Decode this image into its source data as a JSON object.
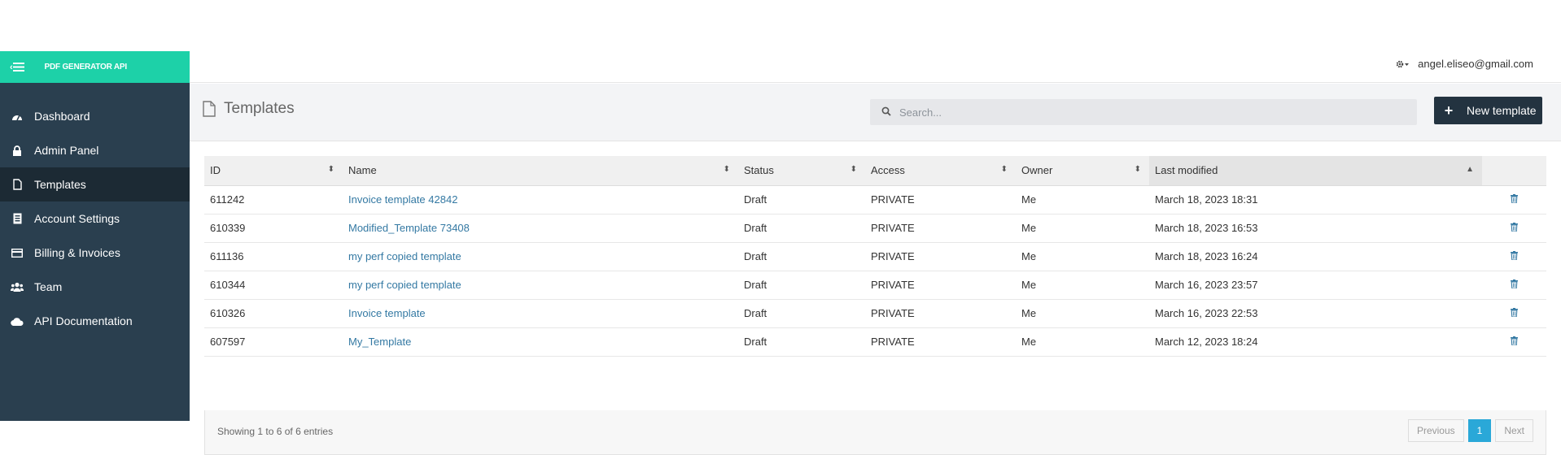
{
  "brand": {
    "name": "PDF GENERATOR API"
  },
  "sidebar": {
    "items": [
      {
        "label": "Dashboard",
        "icon": "dashboard-icon"
      },
      {
        "label": "Admin Panel",
        "icon": "lock-icon"
      },
      {
        "label": "Templates",
        "icon": "document-icon",
        "active": true
      },
      {
        "label": "Account Settings",
        "icon": "id-card-icon"
      },
      {
        "label": "Billing & Invoices",
        "icon": "credit-card-icon"
      },
      {
        "label": "Team",
        "icon": "users-icon"
      },
      {
        "label": "API Documentation",
        "icon": "cloud-icon"
      }
    ]
  },
  "header": {
    "user_email": "angel.eliseo@gmail.com"
  },
  "page": {
    "title": "Templates"
  },
  "search": {
    "placeholder": "Search..."
  },
  "toolbar": {
    "new_template_label": "New template"
  },
  "table": {
    "columns": [
      "ID",
      "Name",
      "Status",
      "Access",
      "Owner",
      "Last modified"
    ],
    "rows": [
      {
        "id": "611242",
        "name": "Invoice template 42842",
        "status": "Draft",
        "access": "PRIVATE",
        "owner": "Me",
        "modified": "March 18, 2023 18:31"
      },
      {
        "id": "610339",
        "name": "Modified_Template 73408",
        "status": "Draft",
        "access": "PRIVATE",
        "owner": "Me",
        "modified": "March 18, 2023 16:53"
      },
      {
        "id": "611136",
        "name": "my perf copied template",
        "status": "Draft",
        "access": "PRIVATE",
        "owner": "Me",
        "modified": "March 18, 2023 16:24"
      },
      {
        "id": "610344",
        "name": "my perf copied template",
        "status": "Draft",
        "access": "PRIVATE",
        "owner": "Me",
        "modified": "March 16, 2023 23:57"
      },
      {
        "id": "610326",
        "name": "Invoice template",
        "status": "Draft",
        "access": "PRIVATE",
        "owner": "Me",
        "modified": "March 16, 2023 22:53"
      },
      {
        "id": "607597",
        "name": "My_Template",
        "status": "Draft",
        "access": "PRIVATE",
        "owner": "Me",
        "modified": "March 12, 2023 18:24"
      }
    ]
  },
  "footer": {
    "info": "Showing 1 to 6 of 6 entries",
    "previous_label": "Previous",
    "current_page": "1",
    "next_label": "Next"
  },
  "colors": {
    "brand": "#1dd1a8",
    "sidebar": "#2a3f4f",
    "link": "#3479a3",
    "pager_active": "#2aa8d8"
  }
}
